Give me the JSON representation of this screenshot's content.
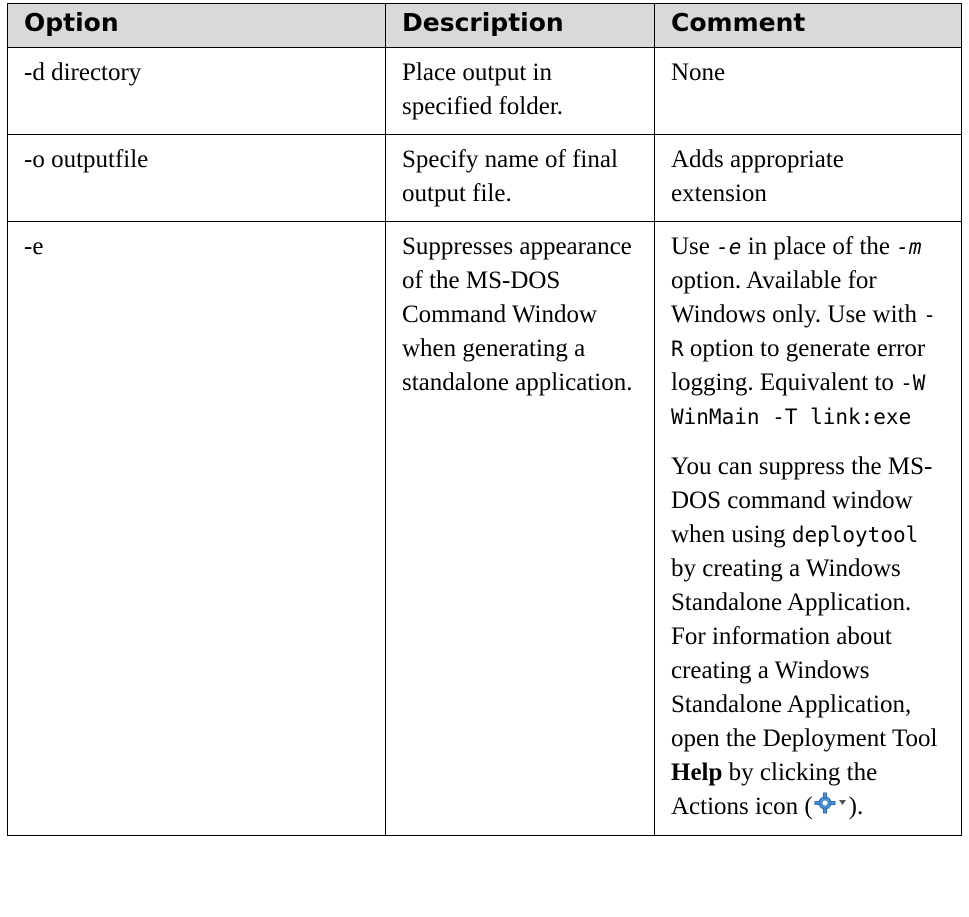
{
  "table": {
    "headers": [
      "Option",
      "Description",
      "Comment"
    ],
    "rows": [
      {
        "option": "-d directory",
        "description": "Place output in specified folder.",
        "comment": "None"
      },
      {
        "option": "-o outputfile",
        "description": "Specify name of final output file.",
        "comment": "Adds appropriate extension"
      },
      {
        "option": "-e",
        "description": "Suppresses appearance of the MS-DOS Command Window when generating a standalone application.",
        "comment": {
          "p1": {
            "t1": "Use ",
            "code1": "-e",
            "t2": " in place of the ",
            "code2": "-m",
            "t3": " option. Available for Windows only. Use with ",
            "code3": "-R",
            "t4": " option to generate error logging. Equivalent to ",
            "code4": "-W WinMain -T link:exe"
          },
          "p2": {
            "t1": "You can suppress the MS-DOS command window when using ",
            "code1": "deploytool",
            "t2": " by creating a Windows Standalone Application.",
            "t3": "For information about creating a Windows Standalone Application, open the Deployment Tool ",
            "bold": "Help",
            "t4": " by clicking the Actions icon (",
            "t5": ")."
          }
        }
      }
    ]
  },
  "icons": {
    "actions": "gear-dropdown-icon"
  },
  "colors": {
    "header_bg": "#d9d9d9",
    "gear": "#4a90d9"
  }
}
